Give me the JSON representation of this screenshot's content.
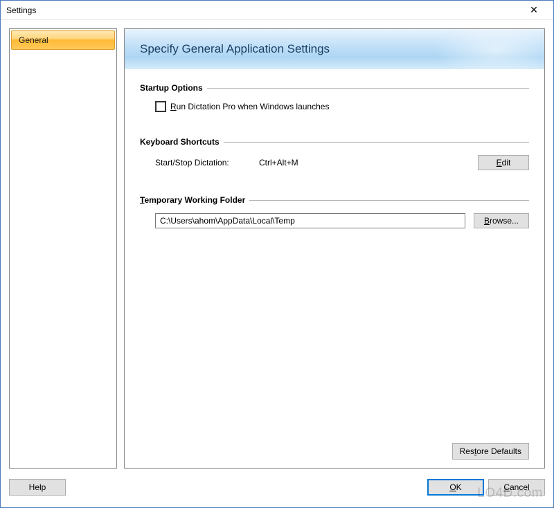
{
  "titlebar": {
    "title": "Settings",
    "close_glyph": "✕"
  },
  "sidebar": {
    "items": [
      {
        "label": "General",
        "selected": true
      }
    ]
  },
  "content": {
    "header_title": "Specify General Application Settings",
    "startup": {
      "section_title": "Startup Options",
      "checkbox_label_pre": "",
      "checkbox_label_u": "R",
      "checkbox_label_post": "un Dictation Pro when Windows launches",
      "checked": false
    },
    "shortcuts": {
      "section_title": "Keyboard Shortcuts",
      "label": "Start/Stop Dictation:",
      "value": "Ctrl+Alt+M",
      "edit_u": "E",
      "edit_post": "dit"
    },
    "temp_folder": {
      "section_title_u": "T",
      "section_title_post": "emporary Working Folder",
      "value": "C:\\Users\\ahom\\AppData\\Local\\Temp",
      "browse_u": "B",
      "browse_post": "rowse..."
    },
    "restore": {
      "label_pre": "Res",
      "label_u": "t",
      "label_post": "ore Defaults"
    }
  },
  "footer": {
    "help_label": "Help",
    "ok_u": "O",
    "ok_post": "K",
    "cancel_u": "C",
    "cancel_post": "ancel"
  },
  "watermark": "LO4D.com"
}
